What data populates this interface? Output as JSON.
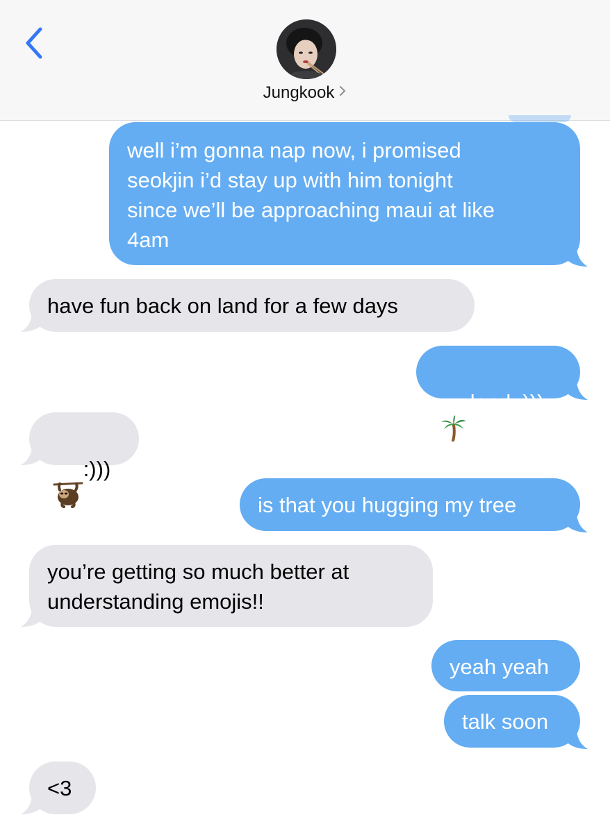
{
  "header": {
    "back_icon": "chevron-left-icon",
    "contact_name": "Jungkook",
    "contact_chevron_icon": "chevron-right-icon",
    "accent_color": "#3478f6"
  },
  "colors": {
    "outgoing_bubble": "#64adf2",
    "incoming_bubble": "#e5e5ea"
  },
  "messages": [
    {
      "direction": "outgoing",
      "text": "well i’m gonna nap now, i promised\nseokjin i’d stay up with him tonight\nsince we’ll be approaching maui at like\n4am"
    },
    {
      "direction": "incoming",
      "text": "have fun back on land for a few days"
    },
    {
      "direction": "outgoing",
      "text": "land :)))",
      "emoji": "palm-tree-icon"
    },
    {
      "direction": "incoming",
      "text": ":)))",
      "emoji": "sloth-icon"
    },
    {
      "direction": "outgoing",
      "text": "is that you hugging my tree"
    },
    {
      "direction": "incoming",
      "text": "you’re getting so much better at\nunderstanding emojis!!"
    },
    {
      "direction": "outgoing",
      "text": "yeah yeah"
    },
    {
      "direction": "outgoing",
      "text": "talk soon"
    },
    {
      "direction": "incoming",
      "text": "<3"
    }
  ]
}
